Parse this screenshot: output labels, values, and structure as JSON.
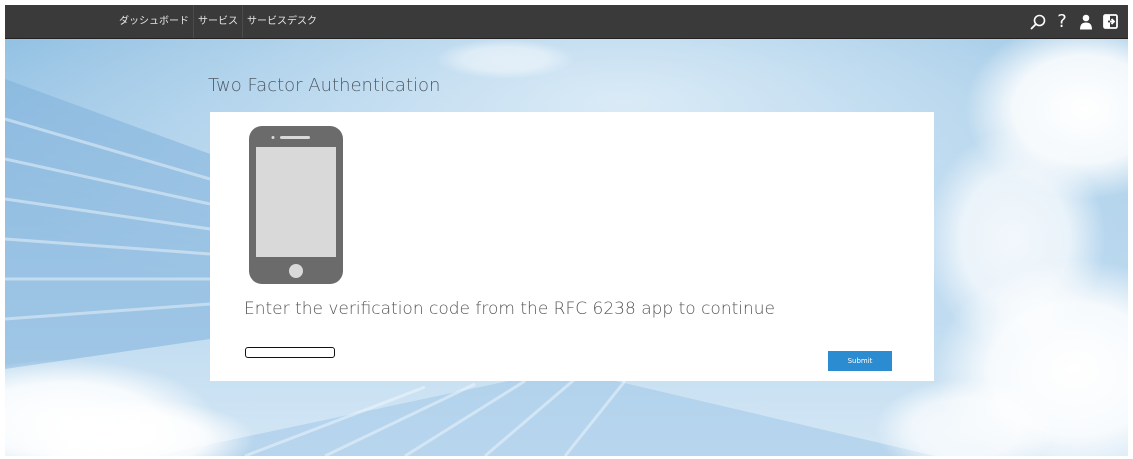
{
  "nav": {
    "items": [
      {
        "label": "ダッシュボード"
      },
      {
        "label": "サービス"
      },
      {
        "label": "サービスデスク"
      }
    ]
  },
  "toolbar": {
    "search_icon": "search-icon",
    "help_label": "?",
    "user_icon": "user-icon",
    "logout_icon": "logout-icon"
  },
  "page": {
    "title": "Two Factor Authentication",
    "instruction": "Enter the verification code from the RFC 6238 app to continue",
    "code_input": {
      "value": "",
      "placeholder": ""
    },
    "submit_label": "Submit"
  },
  "colors": {
    "topbar": "#3a3a3a",
    "accent": "#2b8cd1",
    "phone": "#6b6b6b"
  }
}
